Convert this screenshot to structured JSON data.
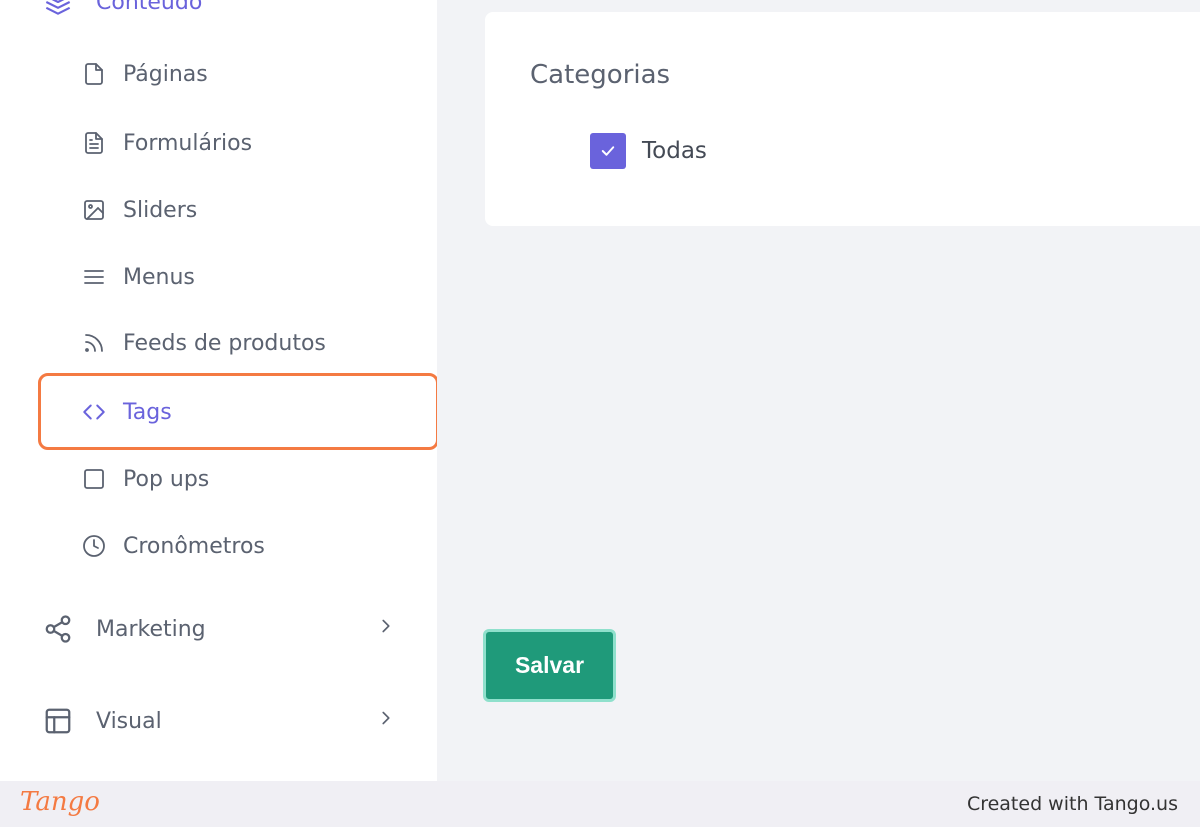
{
  "sidebar": {
    "section_partial_label": "Conteúdo",
    "sub_items": [
      {
        "label": "Páginas",
        "icon": "file-icon"
      },
      {
        "label": "Formulários",
        "icon": "file-text-icon"
      },
      {
        "label": "Sliders",
        "icon": "image-icon"
      },
      {
        "label": "Menus",
        "icon": "menu-icon"
      },
      {
        "label": "Feeds de produtos",
        "icon": "rss-icon"
      },
      {
        "label": "Tags",
        "icon": "code-icon",
        "active": true
      },
      {
        "label": "Pop ups",
        "icon": "square-icon"
      },
      {
        "label": "Cronômetros",
        "icon": "clock-icon"
      }
    ],
    "groups": [
      {
        "label": "Marketing",
        "icon": "share-icon"
      },
      {
        "label": "Visual",
        "icon": "layout-icon"
      }
    ]
  },
  "card": {
    "title": "Categorias",
    "checkbox_label": "Todas",
    "checkbox_checked": true
  },
  "actions": {
    "save_label": "Salvar"
  },
  "footer": {
    "logo": "Tango",
    "created_text": "Created with Tango.us"
  },
  "colors": {
    "accent": "#6a63dc",
    "highlight": "#f47a42",
    "save_button": "#1f9a7a"
  }
}
